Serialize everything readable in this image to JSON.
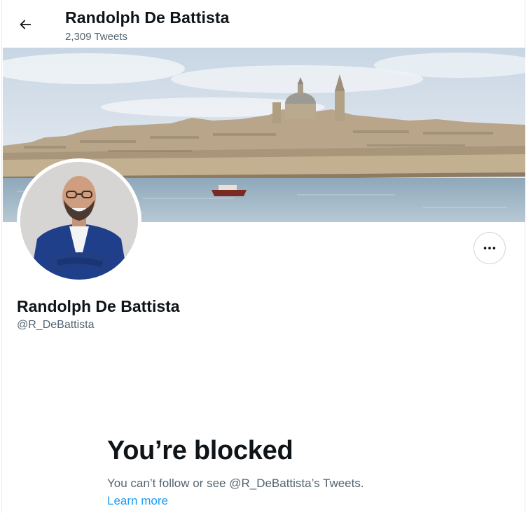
{
  "header": {
    "title": "Randolph De Battista",
    "tweet_count": "2,309 Tweets"
  },
  "profile": {
    "name": "Randolph De Battista",
    "handle": "@R_DeBattista"
  },
  "blocked": {
    "title": "You’re blocked",
    "message": "You can’t follow or see @R_DeBattista’s Tweets.",
    "learn_more": "Learn more"
  },
  "colors": {
    "accent": "#1d9bf0",
    "secondary_text": "#536471",
    "primary_text": "#0f1419"
  },
  "icons": {
    "back": "arrow-left-icon",
    "more": "more-horizontal-icon"
  }
}
